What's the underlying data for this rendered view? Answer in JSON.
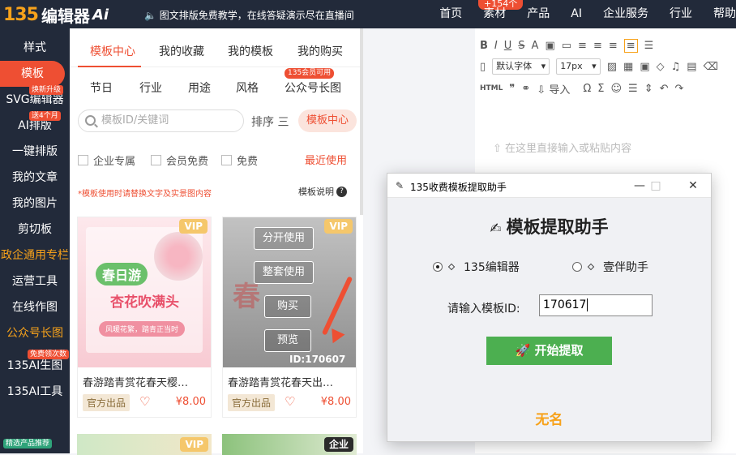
{
  "topbar": {
    "logo_num": "135",
    "logo_text": "编辑器",
    "logo_ai": "Ai",
    "notice": "图文排版免费教学，在线答疑演示尽在直播间",
    "badge": "+154个",
    "nav": [
      "首页",
      "素材",
      "产品",
      "AI",
      "企业服务",
      "行业",
      "帮助"
    ]
  },
  "sidebar": {
    "items": [
      {
        "label": "样式"
      },
      {
        "label": "模板",
        "active": true
      },
      {
        "label": "SVG编辑器",
        "tag": "焕新升级"
      },
      {
        "label": "AI排版",
        "tag": "送4个月"
      },
      {
        "label": "一键排版"
      },
      {
        "label": "我的文章"
      },
      {
        "label": "我的图片"
      },
      {
        "label": "剪切板"
      },
      {
        "label": "政企通用专栏",
        "orange": true
      },
      {
        "label": "运营工具"
      },
      {
        "label": "在线作图"
      },
      {
        "label": "公众号长图",
        "orange": true
      },
      {
        "label": "135AI生图",
        "tag": "免费领次数"
      },
      {
        "label": "135AI工具"
      }
    ],
    "bottom_tag": "精选产品推荐"
  },
  "panel": {
    "tabs": [
      "模板中心",
      "我的收藏",
      "我的模板",
      "我的购买"
    ],
    "subtabs": [
      "节日",
      "行业",
      "用途",
      "风格",
      "公众号长图"
    ],
    "vip_badge": "135会员可用",
    "search_placeholder": "模板ID/关键词",
    "sort_label": "排序",
    "center_button": "模板中心",
    "filters": [
      "企业专属",
      "会员免费",
      "免费"
    ],
    "recent": "最近使用",
    "tip": "*模板使用时请替换文字及实景图内容",
    "help": "模板说明",
    "cards": [
      {
        "vip": "VIP",
        "img_title": "春日游",
        "img_subtitle": "杏花吹满头",
        "img_caption": "风暖花繁，踏青正当时",
        "title": "春游踏青赏花春天樱…",
        "official": "官方出品",
        "price": "¥8.00"
      },
      {
        "vip": "VIP",
        "overlay_buttons": [
          "分开使用",
          "整套使用",
          "购买",
          "预览"
        ],
        "id_label": "ID:170607",
        "title": "春游踏青赏花春天出…",
        "official": "官方出品",
        "price": "¥8.00"
      }
    ],
    "bottom_tags": [
      "VIP",
      "企业"
    ]
  },
  "editor": {
    "font_name": "默认字体",
    "font_size": "17px",
    "html_label": "HTML",
    "import_label": "导入",
    "placeholder": "在这里直接输入或粘贴内容"
  },
  "dialog": {
    "title": "135收费模板提取助手",
    "heading": "模板提取助手",
    "options": [
      "135编辑器",
      "壹伴助手"
    ],
    "selected": "135编辑器",
    "id_label": "请输入模板ID:",
    "id_value": "170617",
    "start_button": "开始提取",
    "footer": "无名"
  },
  "colors": {
    "accent": "#ee4f33",
    "dark": "#222a3a",
    "green": "#4caf50",
    "orange": "#f7a21b"
  }
}
